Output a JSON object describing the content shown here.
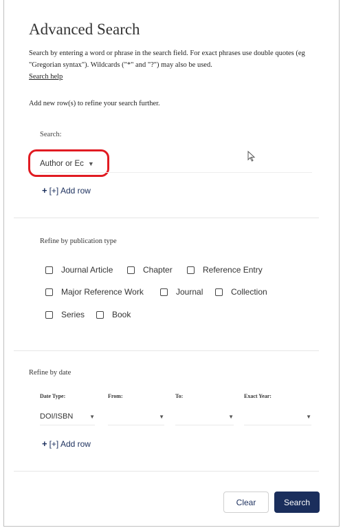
{
  "page": {
    "title": "Advanced Search",
    "intro_text": "Search by entering a word or phrase in the search field. For exact phrases use double quotes (eg \"Gregorian syntax\"). Wildcards (\"*\" and \"?\") may also be used.",
    "help_link": "Search help",
    "add_rows_text": "Add new row(s) to refine your search further."
  },
  "search": {
    "label": "Search:",
    "field_value": "Author or Ec",
    "add_row": "[+] Add row",
    "add_row_icon": "+"
  },
  "publication_type": {
    "title": "Refine by publication type",
    "options": [
      "Journal Article",
      "Chapter",
      "Reference Entry",
      "Major Reference Work",
      "Journal",
      "Collection",
      "Series",
      "Book"
    ]
  },
  "date": {
    "title": "Refine by date",
    "columns": [
      "Date Type:",
      "From:",
      "To:",
      "Exact Year:"
    ],
    "date_type_value": "DOI/ISBN",
    "add_row": "[+] Add row",
    "add_row_icon": "+"
  },
  "actions": {
    "clear": "Clear",
    "search": "Search"
  },
  "colors": {
    "primary": "#1a2e5c",
    "highlight": "#e11b22"
  }
}
